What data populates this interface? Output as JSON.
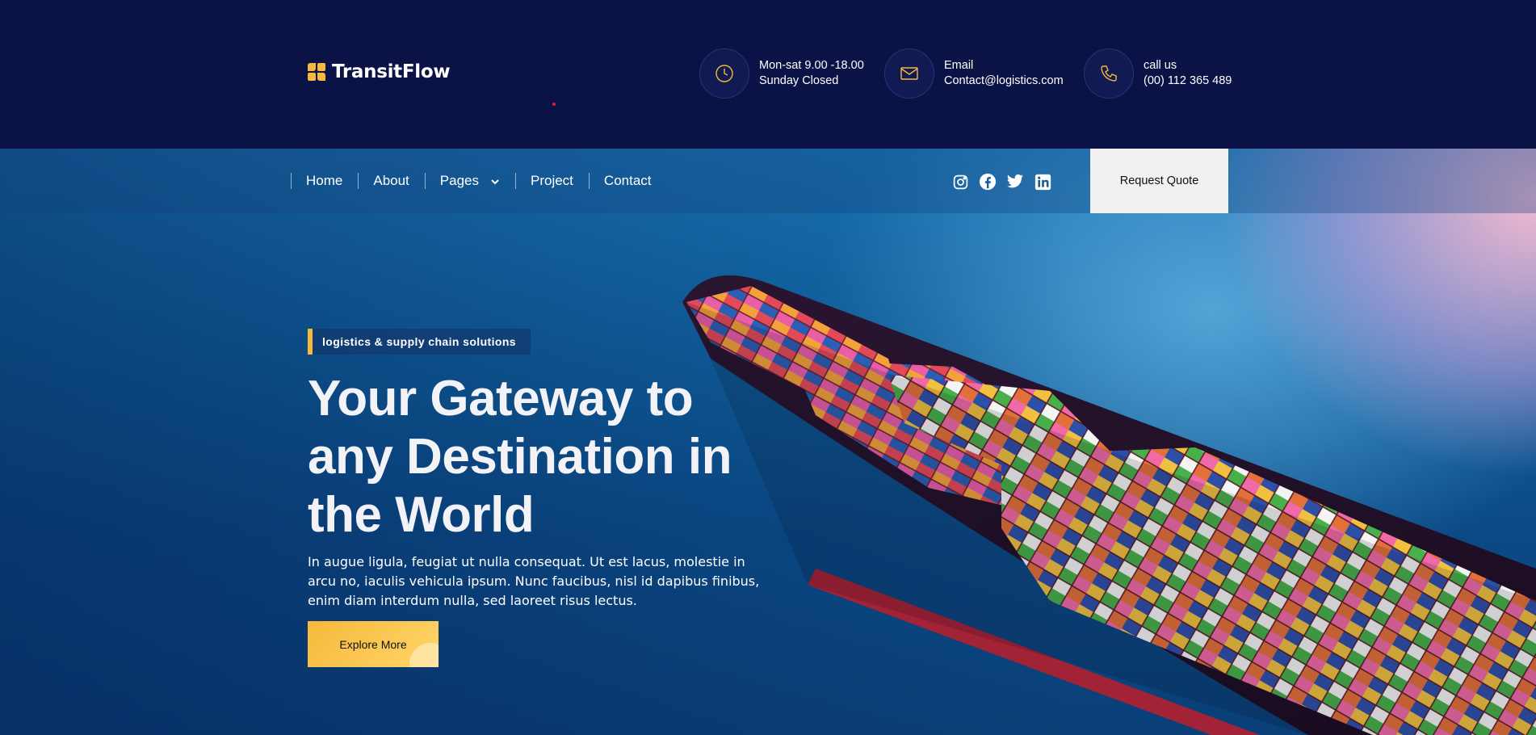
{
  "brand": {
    "name": "TransitFlow"
  },
  "header": {
    "hours": {
      "line1": "Mon-sat 9.00 -18.00",
      "line2": "Sunday Closed"
    },
    "email": {
      "line1": "Email",
      "line2": "Contact@logistics.com"
    },
    "phone": {
      "line1": "call us",
      "line2": "(00) 112 365 489"
    }
  },
  "nav": {
    "items": [
      "Home",
      "About",
      "Pages",
      "Project",
      "Contact"
    ],
    "quote_label": "Request Quote",
    "socials": [
      "instagram-icon",
      "facebook-icon",
      "twitter-icon",
      "linkedin-icon"
    ]
  },
  "hero": {
    "tag": "logistics & supply chain solutions",
    "title": "Your Gateway to any Destination in the World",
    "description": "In augue ligula, feugiat ut nulla consequat. Ut est lacus, molestie in arcu no, iaculis vehicula ipsum. Nunc faucibus, nisl id dapibus finibus, enim diam interdum nulla, sed laoreet risus lectus.",
    "button": "Explore More"
  },
  "colors": {
    "navy": "#0b1246",
    "accent": "#f6b93b",
    "sea": "#0f5f9c"
  }
}
